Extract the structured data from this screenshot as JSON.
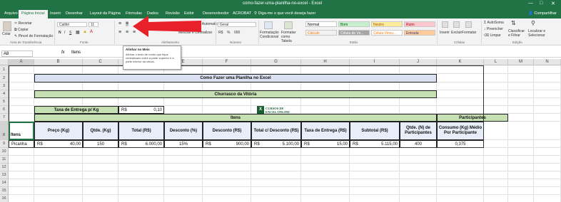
{
  "window": {
    "title": "como-fazer-uma-planilha-no-excel  -  Excel",
    "controls": [
      "—",
      "□",
      "✕"
    ]
  },
  "tabs": [
    "Arquivo",
    "Página Inicial",
    "Inserir",
    "Desenhar",
    "Layout da Página",
    "Fórmulas",
    "Dados",
    "Revisão",
    "Exibir",
    "Desenvolvedor",
    "ACROBAT"
  ],
  "tell_me": "Diga-me o que você deseja fazer",
  "share": "Compartilhar",
  "ribbon": {
    "clipboard": {
      "paste": "Colar",
      "cut": "Recortar",
      "copy": "Copiar",
      "format_painter": "Pincel de Formatação",
      "group": "Área de Transferência"
    },
    "font": {
      "name": "Calibri",
      "size": "11",
      "bold": "N",
      "italic": "I",
      "underline": "S",
      "group": "Fonte"
    },
    "alignment": {
      "wrap": "Quebrar Texto Automaticamente",
      "merge": "Mesclar e Centralizar",
      "group": "Alinhamento"
    },
    "number": {
      "format": "Geral",
      "currency": "R$",
      "percent": "%",
      "thousands": "000",
      "group": "Número"
    },
    "styles": {
      "conditional": "Formatação Condicional",
      "table": "Formatar como Tabela",
      "cells": [
        {
          "label": "Normal",
          "bg": "#ffffff",
          "fg": "#000000"
        },
        {
          "label": "Bom",
          "bg": "#c6efce",
          "fg": "#006100"
        },
        {
          "label": "Neutro",
          "bg": "#ffeb9c",
          "fg": "#9c5700"
        },
        {
          "label": "Ruim",
          "bg": "#ffc7ce",
          "fg": "#9c0006"
        },
        {
          "label": "Cálculo",
          "bg": "#f2f2f2",
          "fg": "#fa7d00"
        },
        {
          "label": "Célula de Ve...",
          "bg": "#a5a5a5",
          "fg": "#ffffff"
        },
        {
          "label": "Célula Vincu...",
          "bg": "#ffffff",
          "fg": "#fa7d00"
        },
        {
          "label": "Entrada",
          "bg": "#ffcc99",
          "fg": "#3f3f76"
        }
      ],
      "group": "Estilo"
    },
    "cells": {
      "insert": "Inserir",
      "delete": "Excluir",
      "format": "Formatar",
      "group": "Células"
    },
    "editing": {
      "autosum": "AutoSoma",
      "fill": "Preencher",
      "clear": "Limpar",
      "sort": "Classificar e Filtrar",
      "find": "Localizar e Selecionar",
      "group": "Edição"
    }
  },
  "tooltip": {
    "title": "Alinhar no Meio",
    "body": "Alinhar o texto de modo que fique centralizado entre a parte superior e a parte inferior da célula."
  },
  "formula_bar": {
    "name_box": "A8",
    "fx": "fx",
    "content": "Itens"
  },
  "columns": [
    "A",
    "B",
    "C",
    "D",
    "E",
    "F",
    "G",
    "H",
    "I",
    "J",
    "K",
    "L",
    "M",
    "N"
  ],
  "rows": [
    "1",
    "2",
    "3",
    "4",
    "5",
    "6",
    "7",
    "8",
    "9",
    "10",
    "11",
    "12",
    "13",
    "14",
    "15",
    "16"
  ],
  "sheet": {
    "title": "Como Fazer uma Planilha no Excel",
    "subtitle": "Churrasco da Vitória",
    "tax_label": "Taxa de Entrega p/ Kg",
    "tax_currency": "R$",
    "tax_value": "0,10",
    "logo_line1": "CURSOS DE",
    "logo_line2": "EXCEL ONLINE",
    "logo_mark": "X",
    "group_items": "Itens",
    "group_participants": "Participantes",
    "headers": [
      "Itens",
      "Preço (Kg)",
      "Qtde. (Kg)",
      "Total (R$)",
      "Desconto (%)",
      "Desconto (R$)",
      "Total c/ Desconto (R$)",
      "Taxa de Entrega (R$)",
      "Subtotal (R$)",
      "Qtde. (N) de Participantes",
      "Consumo (Kg) Médio Por Participante"
    ],
    "row9": {
      "item": "Picanha",
      "price_cur": "R$",
      "price": "40,00",
      "qty": "150",
      "total_cur": "R$",
      "total": "6.000,00",
      "disc_pct": "15%",
      "disc_cur": "R$",
      "disc": "900,00",
      "tcd_cur": "R$",
      "tcd": "5.100,00",
      "fee_cur": "R$",
      "fee": "15,00",
      "sub_cur": "R$",
      "sub": "5.115,00",
      "participants": "400",
      "consumption": "0,375"
    }
  },
  "colors": {
    "excel_green": "#217346",
    "arrow_red": "#e8202a",
    "header_fill": "#d9e1f2",
    "section_fill": "#c6e0b4"
  }
}
